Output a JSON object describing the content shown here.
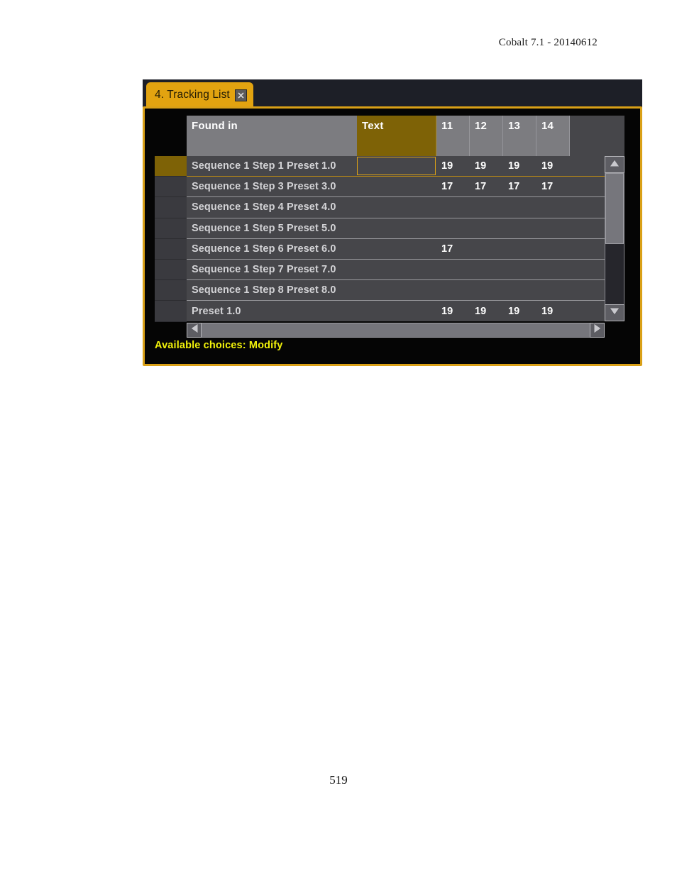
{
  "document": {
    "header": "Cobalt 7.1 - 20140612",
    "page_number": "519"
  },
  "window": {
    "tab": {
      "label": "4. Tracking List",
      "close_icon": "close-icon"
    },
    "accent_color": "#d9a017",
    "highlight_color": "#7e6206",
    "status_color": "#f2f20a"
  },
  "table": {
    "columns": [
      {
        "key": "found_in",
        "label": "Found in",
        "type": "text"
      },
      {
        "key": "text",
        "label": "Text",
        "type": "text",
        "highlighted": true
      },
      {
        "key": "c11",
        "label": "11",
        "type": "number"
      },
      {
        "key": "c12",
        "label": "12",
        "type": "number"
      },
      {
        "key": "c13",
        "label": "13",
        "type": "number"
      },
      {
        "key": "c14",
        "label": "14",
        "type": "number"
      }
    ],
    "rows": [
      {
        "found_in": "Sequence 1 Step 1 Preset 1.0",
        "text": "",
        "c11": "19",
        "c12": "19",
        "c13": "19",
        "c14": "19",
        "selected": true,
        "editing_cell": "text"
      },
      {
        "found_in": "Sequence 1 Step 3 Preset 3.0",
        "text": "",
        "c11": "17",
        "c12": "17",
        "c13": "17",
        "c14": "17",
        "selected": false
      },
      {
        "found_in": "Sequence 1 Step 4 Preset 4.0",
        "text": "",
        "c11": "",
        "c12": "",
        "c13": "",
        "c14": "",
        "selected": false
      },
      {
        "found_in": "Sequence 1 Step 5 Preset 5.0",
        "text": "",
        "c11": "",
        "c12": "",
        "c13": "",
        "c14": "",
        "selected": false
      },
      {
        "found_in": "Sequence 1 Step 6 Preset 6.0",
        "text": "",
        "c11": "17",
        "c12": "",
        "c13": "",
        "c14": "",
        "selected": false
      },
      {
        "found_in": "Sequence 1 Step 7 Preset 7.0",
        "text": "",
        "c11": "",
        "c12": "",
        "c13": "",
        "c14": "",
        "selected": false
      },
      {
        "found_in": "Sequence 1 Step 8 Preset 8.0",
        "text": "",
        "c11": "",
        "c12": "",
        "c13": "",
        "c14": "",
        "selected": false
      },
      {
        "found_in": "Preset 1.0",
        "text": "",
        "c11": "19",
        "c12": "19",
        "c13": "19",
        "c14": "19",
        "selected": false
      }
    ]
  },
  "scrollbars": {
    "vertical": {
      "up_icon": "triangle-up-icon",
      "down_icon": "triangle-down-icon",
      "thumb_fraction": 0.54
    },
    "horizontal": {
      "left_icon": "triangle-left-icon",
      "right_icon": "triangle-right-icon",
      "thumb_fraction": 1.0
    }
  },
  "status": {
    "text": "Available choices: Modify"
  }
}
